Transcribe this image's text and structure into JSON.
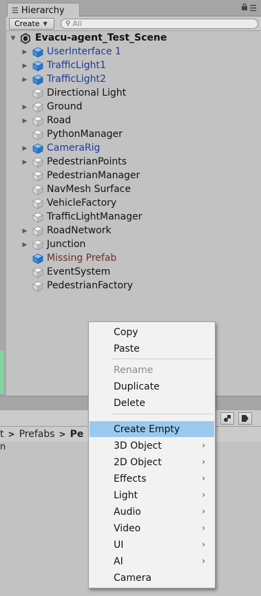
{
  "hierarchy": {
    "tab_label": "Hierarchy",
    "tab_icon": "list-icon",
    "create_label": "Create",
    "search_placeholder": "All",
    "scene_name": "Evacu-agent_Test_Scene",
    "items": [
      {
        "label": "UserInterface 1",
        "style": "prefab",
        "expandable": true
      },
      {
        "label": "TrafficLight1",
        "style": "prefab",
        "expandable": true
      },
      {
        "label": "TrafficLight2",
        "style": "prefab",
        "expandable": true
      },
      {
        "label": "Directional Light",
        "style": "normal",
        "expandable": false
      },
      {
        "label": "Ground",
        "style": "normal",
        "expandable": true
      },
      {
        "label": "Road",
        "style": "normal",
        "expandable": true
      },
      {
        "label": "PythonManager",
        "style": "normal",
        "expandable": false
      },
      {
        "label": "CameraRig",
        "style": "prefab",
        "expandable": true
      },
      {
        "label": "PedestrianPoints",
        "style": "normal",
        "expandable": true
      },
      {
        "label": "PedestrianManager",
        "style": "normal",
        "expandable": false
      },
      {
        "label": "NavMesh Surface",
        "style": "normal",
        "expandable": false
      },
      {
        "label": "VehicleFactory",
        "style": "normal",
        "expandable": false
      },
      {
        "label": "TrafficLightManager",
        "style": "normal",
        "expandable": false
      },
      {
        "label": "RoadNetwork",
        "style": "normal",
        "expandable": true
      },
      {
        "label": "Junction",
        "style": "normal",
        "expandable": true
      },
      {
        "label": "Missing Prefab",
        "style": "missing",
        "expandable": false
      },
      {
        "label": "EventSystem",
        "style": "normal",
        "expandable": false
      },
      {
        "label": "PedestrianFactory",
        "style": "normal",
        "expandable": false
      }
    ]
  },
  "project": {
    "breadcrumb": [
      "t",
      "Prefabs",
      "Pe"
    ],
    "first_row": "n"
  },
  "context_menu": {
    "items": [
      {
        "label": "Copy",
        "enabled": true,
        "submenu": false
      },
      {
        "label": "Paste",
        "enabled": true,
        "submenu": false
      },
      {
        "label": "Rename",
        "enabled": false,
        "submenu": false
      },
      {
        "label": "Duplicate",
        "enabled": true,
        "submenu": false
      },
      {
        "label": "Delete",
        "enabled": true,
        "submenu": false
      },
      {
        "label": "Create Empty",
        "enabled": true,
        "submenu": false,
        "highlighted": true
      },
      {
        "label": "3D Object",
        "enabled": true,
        "submenu": true
      },
      {
        "label": "2D Object",
        "enabled": true,
        "submenu": true
      },
      {
        "label": "Effects",
        "enabled": true,
        "submenu": true
      },
      {
        "label": "Light",
        "enabled": true,
        "submenu": true
      },
      {
        "label": "Audio",
        "enabled": true,
        "submenu": true
      },
      {
        "label": "Video",
        "enabled": true,
        "submenu": true
      },
      {
        "label": "UI",
        "enabled": true,
        "submenu": true
      },
      {
        "label": "AI",
        "enabled": true,
        "submenu": true
      },
      {
        "label": "Camera",
        "enabled": true,
        "submenu": false
      }
    ]
  },
  "colors": {
    "prefab_text": "#1e3c96",
    "missing_text": "#6d2d2d",
    "highlight": "#99c9ef",
    "panel_bg": "#c2c2c2"
  }
}
